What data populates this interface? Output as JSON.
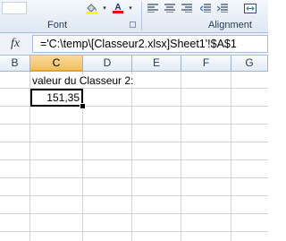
{
  "ribbon": {
    "groups": [
      {
        "label": "Font"
      },
      {
        "label": "Alignment"
      }
    ],
    "icons": [
      "fill-color-icon",
      "font-color-icon",
      "align-icon",
      "dialog-launcher-icon"
    ],
    "accent_colors": {
      "fill": "#ffff00",
      "font": "#ff0000"
    }
  },
  "formula_bar": {
    "fx_label": "fx",
    "formula": "='C:\\temp\\[Classeur2.xlsx]Sheet1'!$A$1"
  },
  "columns": [
    "B",
    "C",
    "D",
    "E",
    "F",
    "G"
  ],
  "selected_column": "C",
  "cells": {
    "label": "valeur du Classeur 2:",
    "value": "151,35"
  }
}
